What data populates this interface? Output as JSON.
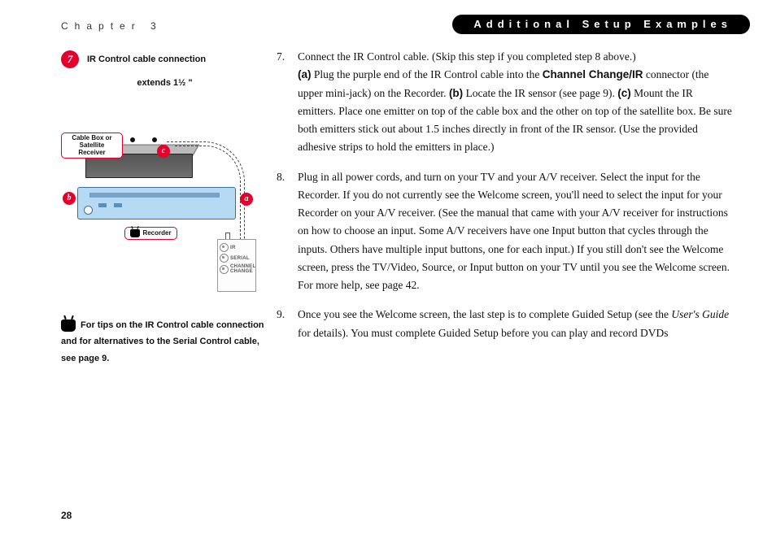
{
  "header": {
    "chapter": "Chapter 3",
    "banner": "Additional Setup Examples"
  },
  "figure": {
    "step_number": "7",
    "title": "IR Control cable connection",
    "extends_label": "extends 1½ \"",
    "callouts": {
      "cable_box": "Cable Box or Satellite Receiver",
      "recorder": "Recorder"
    },
    "labels": {
      "a": "a",
      "b": "b",
      "c": "c"
    },
    "ports": {
      "ir": "IR",
      "serial": "SERIAL",
      "channel_change": "CHANNEL CHANGE"
    }
  },
  "tip": {
    "text": "For tips on the IR Control cable connection and for alternatives to the Serial Control cable, see page 9."
  },
  "body": {
    "items": [
      {
        "num": "7.",
        "lead": "Connect the IR Control cable. (Skip this step if you completed step 8 above.)",
        "a_label": "(a)",
        "a_text_pre": " Plug the purple end of the IR Control cable into the ",
        "a_bold": "Channel Change/IR",
        "a_text_post": " connector (the upper mini-jack) on the Recorder. ",
        "b_label": "(b)",
        "b_text": " Locate the IR sensor (see page 9). ",
        "c_label": "(c)",
        "c_text": " Mount the IR emitters. Place one emitter on top of the cable box and the other on top of the satellite box. Be sure both emitters stick out about 1.5 inches directly in front of the IR sensor. (Use the provided adhesive strips to hold the emitters in place.)"
      },
      {
        "num": "8.",
        "text": "Plug in all power cords, and turn on your TV and your A/V receiver. Select the input for the Recorder. If you do not currently see the Welcome screen, you'll need to select the input for your Recorder on your A/V receiver. (See the manual that came with your A/V receiver for instructions on how to choose an input. Some A/V receivers have one Input button that cycles through the inputs. Others have multiple input buttons, one for each input.) If you still don't see the Welcome screen, press the TV/Video, Source, or Input button on your TV until you see the Welcome screen. For more help, see page 42."
      },
      {
        "num": "9.",
        "pre": "Once you see the Welcome screen, the last step is to complete Guided Setup (see the ",
        "ital": "User's Guide",
        "post": " for details). You must complete Guided Setup before you can play and record DVDs"
      }
    ]
  },
  "page_number": "28"
}
